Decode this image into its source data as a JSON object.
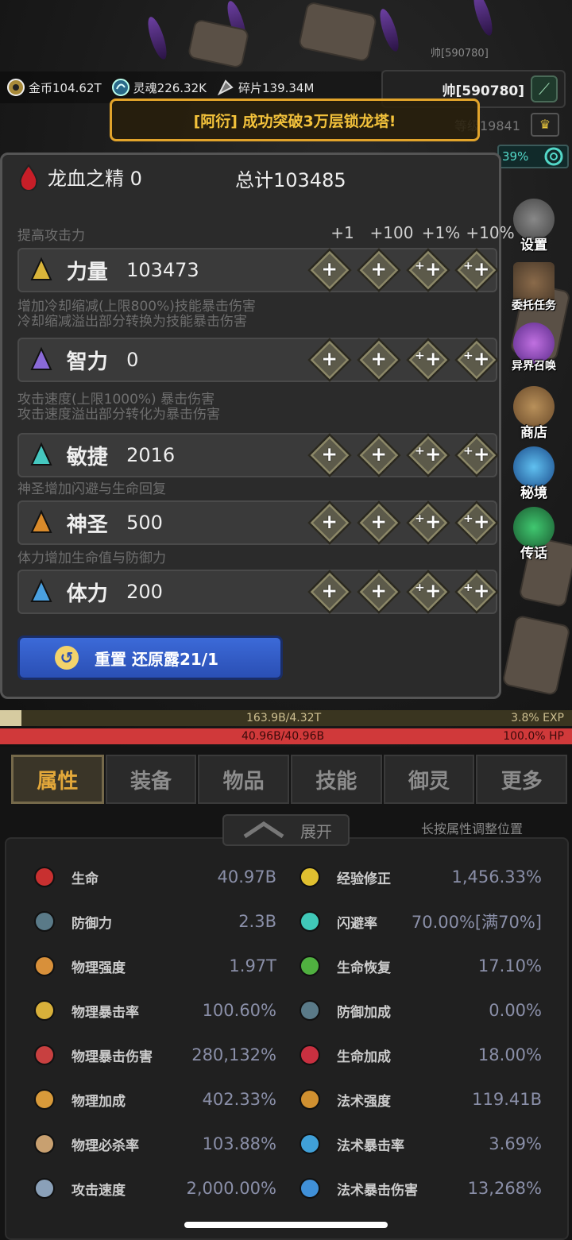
{
  "hud": {
    "top_name": "帅[590780]",
    "gold": "金币104.62T",
    "soul": "灵魂226.32K",
    "shard": "碎片139.34M",
    "player": "帅[590780]",
    "level": "等级19841",
    "percent": "39%"
  },
  "banner": "[阿衍] 成功突破3万层锁龙塔!",
  "side": [
    "设置",
    "委托任务",
    "异界召唤",
    "商店",
    "秘境",
    "传话"
  ],
  "panel": {
    "title": "龙血之精 0",
    "total": "总计103485",
    "col_headers": [
      "+1",
      "+100",
      "+1%",
      "+10%"
    ],
    "stats": [
      {
        "label": "力量",
        "value": "103473",
        "desc": [
          "提高攻击力"
        ],
        "color": "#d9b43a"
      },
      {
        "label": "智力",
        "value": "0",
        "desc": [
          "增加冷却缩减(上限800%)技能暴击伤害",
          "冷却缩减溢出部分转换为技能暴击伤害"
        ],
        "color": "#8a6ad8"
      },
      {
        "label": "敏捷",
        "value": "2016",
        "desc": [
          "攻击速度(上限1000%) 暴击伤害",
          "攻击速度溢出部分转化为暴击伤害"
        ],
        "color": "#45c8c0"
      },
      {
        "label": "神圣",
        "value": "500",
        "desc": [
          "神圣增加闪避与生命回复"
        ],
        "color": "#d98a2a"
      },
      {
        "label": "体力",
        "value": "200",
        "desc": [
          "体力增加生命值与防御力"
        ],
        "color": "#4aa0e0"
      }
    ],
    "plus_glyphs": [
      "+",
      "+",
      "⁺+",
      "⁺+"
    ],
    "reset": "重置 还原露21/1"
  },
  "bars": {
    "exp": "163.9B/4.32T",
    "exp_pct": "3.8%  EXP",
    "exp_fraction": 0.038,
    "hp": "40.96B/40.96B",
    "hp_pct": "100.0%  HP"
  },
  "tabs": [
    "属性",
    "装备",
    "物品",
    "技能",
    "御灵",
    "更多"
  ],
  "expand": "展开",
  "hint": "长按属性调整位置",
  "attrs_left": [
    {
      "n": "生命",
      "v": "40.97B",
      "i": "heart-icon",
      "c": "#c83030"
    },
    {
      "n": "防御力",
      "v": "2.3B",
      "i": "shield-icon",
      "c": "#5a7a88"
    },
    {
      "n": "物理强度",
      "v": "1.97T",
      "i": "arrow-icon",
      "c": "#d8903a"
    },
    {
      "n": "物理暴击率",
      "v": "100.60%",
      "i": "crit-icon",
      "c": "#d8b03a"
    },
    {
      "n": "物理暴击伤害",
      "v": "280,132%",
      "i": "crit-dmg-icon",
      "c": "#c84040"
    },
    {
      "n": "物理加成",
      "v": "402.33%",
      "i": "sword-icon",
      "c": "#d89a3a"
    },
    {
      "n": "物理必杀率",
      "v": "103.88%",
      "i": "skull-icon",
      "c": "#c8a070"
    },
    {
      "n": "攻击速度",
      "v": "2,000.00%",
      "i": "speed-icon",
      "c": "#8aa0b8"
    }
  ],
  "attrs_right": [
    {
      "n": "经验修正",
      "v": "1,456.33%",
      "i": "crown-icon",
      "c": "#e0c030"
    },
    {
      "n": "闪避率",
      "v": "70.00%[满70%]",
      "i": "dodge-icon",
      "c": "#40c8b8"
    },
    {
      "n": "生命恢复",
      "v": "17.10%",
      "i": "leaf-icon",
      "c": "#50b040"
    },
    {
      "n": "防御加成",
      "v": "0.00%",
      "i": "shield-plus-icon",
      "c": "#5a7a88"
    },
    {
      "n": "生命加成",
      "v": "18.00%",
      "i": "heart-plus-icon",
      "c": "#c83040"
    },
    {
      "n": "法术强度",
      "v": "119.41B",
      "i": "magic-icon",
      "c": "#d09030"
    },
    {
      "n": "法术暴击率",
      "v": "3.69%",
      "i": "magic-crit-icon",
      "c": "#40a0d8"
    },
    {
      "n": "法术暴击伤害",
      "v": "13,268%",
      "i": "magic-dmg-icon",
      "c": "#4090d8"
    }
  ]
}
